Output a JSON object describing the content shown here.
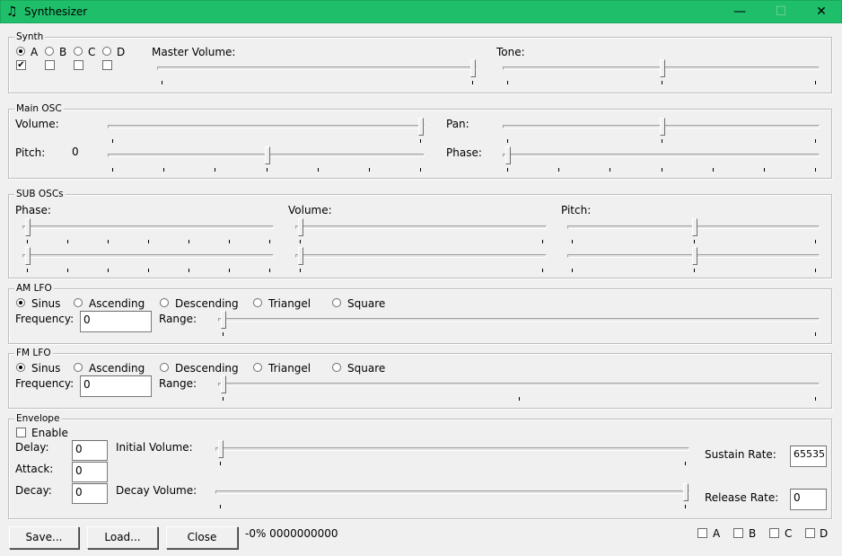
{
  "window": {
    "title": "Synthesizer",
    "app_icon": "♫",
    "minimize": "—",
    "maximize": "☐",
    "close": "✕"
  },
  "synth": {
    "group_label": "Synth",
    "channels": [
      {
        "label": "A",
        "selected": true,
        "checked": true
      },
      {
        "label": "B",
        "selected": false,
        "checked": false
      },
      {
        "label": "C",
        "selected": false,
        "checked": false
      },
      {
        "label": "D",
        "selected": false,
        "checked": false
      }
    ],
    "master_volume_label": "Master Volume:",
    "master_volume_level": 1.0,
    "tone_label": "Tone:",
    "tone_level": 0.5
  },
  "main_osc": {
    "group_label": "Main OSC",
    "volume_label": "Volume:",
    "volume_level": 1.0,
    "pan_label": "Pan:",
    "pan_level": 0.5,
    "pitch_label": "Pitch:",
    "pitch_value": "0",
    "pitch_level": 0.5,
    "phase_label": "Phase:",
    "phase_level": 0.0
  },
  "sub_oscs": {
    "group_label": "SUB OSCs",
    "phase_label": "Phase:",
    "volume_label": "Volume:",
    "pitch_label": "Pitch:",
    "phase_levels": [
      0.0,
      0.0
    ],
    "volume_levels": [
      0.0,
      0.0
    ],
    "pitch_levels": [
      0.5,
      0.5
    ]
  },
  "am_lfo": {
    "group_label": "AM LFO",
    "waveforms": [
      {
        "label": "Sinus",
        "selected": true
      },
      {
        "label": "Ascending",
        "selected": false
      },
      {
        "label": "Descending",
        "selected": false
      },
      {
        "label": "Triangel",
        "selected": false
      },
      {
        "label": "Square",
        "selected": false
      }
    ],
    "frequency_label": "Frequency:",
    "frequency_value": "0",
    "range_label": "Range:",
    "range_level": 0.0
  },
  "fm_lfo": {
    "group_label": "FM LFO",
    "waveforms": [
      {
        "label": "Sinus",
        "selected": true
      },
      {
        "label": "Ascending",
        "selected": false
      },
      {
        "label": "Descending",
        "selected": false
      },
      {
        "label": "Triangel",
        "selected": false
      },
      {
        "label": "Square",
        "selected": false
      }
    ],
    "frequency_label": "Frequency:",
    "frequency_value": "0",
    "range_label": "Range:",
    "range_level": 0.0
  },
  "envelope": {
    "group_label": "Envelope",
    "enable_label": "Enable",
    "enabled": false,
    "delay_label": "Delay:",
    "delay_value": "0",
    "attack_label": "Attack:",
    "attack_value": "0",
    "decay_label": "Decay:",
    "decay_value": "0",
    "initial_volume_label": "Initial Volume:",
    "initial_volume_level": 0.0,
    "decay_volume_label": "Decay Volume:",
    "decay_volume_level": 1.0,
    "sustain_rate_label": "Sustain Rate:",
    "sustain_rate_value": "65535",
    "release_rate_label": "Release Rate:",
    "release_rate_value": "0"
  },
  "footer": {
    "save_label": "Save...",
    "load_label": "Load...",
    "close_label": "Close",
    "status_text": "-0% 0000000000",
    "channels": [
      {
        "label": "A",
        "checked": false
      },
      {
        "label": "B",
        "checked": false
      },
      {
        "label": "C",
        "checked": false
      },
      {
        "label": "D",
        "checked": false
      }
    ]
  }
}
